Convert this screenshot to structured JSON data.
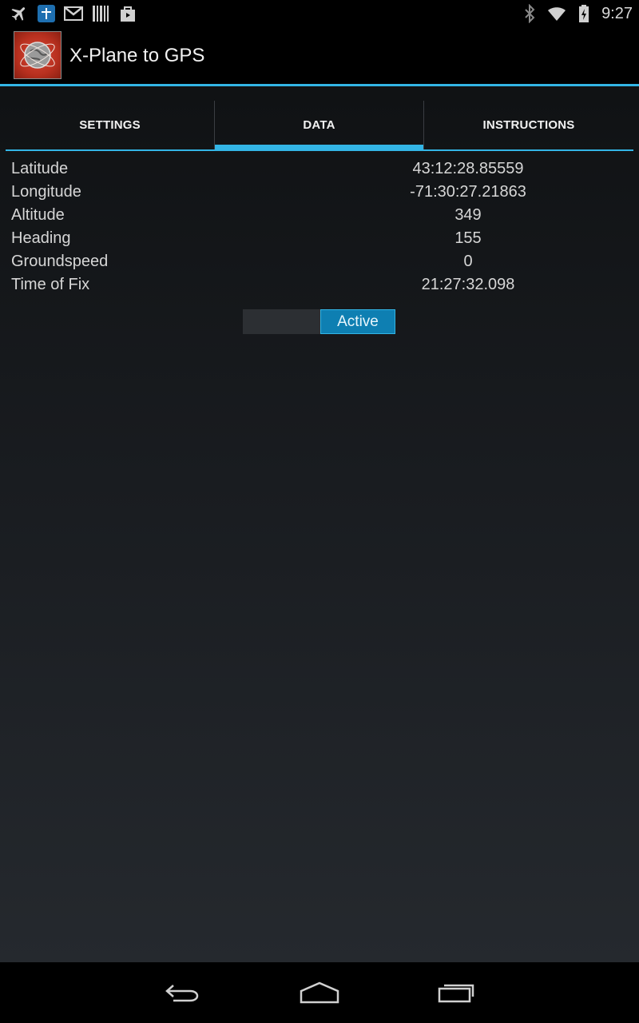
{
  "status_bar": {
    "time": "9:27",
    "left_icons": [
      "airplane-icon",
      "app-notification-icon",
      "gmail-icon",
      "barcode-icon",
      "shopping-bag-icon"
    ],
    "right_icons": [
      "bluetooth-icon",
      "wifi-icon",
      "battery-charging-icon"
    ]
  },
  "app": {
    "title": "X-Plane to GPS",
    "logo_icon": "app-logo-icon"
  },
  "tabs": [
    {
      "label": "SETTINGS",
      "selected": false
    },
    {
      "label": "DATA",
      "selected": true
    },
    {
      "label": "INSTRUCTIONS",
      "selected": false
    }
  ],
  "data_rows": [
    {
      "label": "Latitude",
      "value": "43:12:28.85559"
    },
    {
      "label": "Longitude",
      "value": "-71:30:27.21863"
    },
    {
      "label": "Altitude",
      "value": "349"
    },
    {
      "label": "Heading",
      "value": "155"
    },
    {
      "label": "Groundspeed",
      "value": "0"
    },
    {
      "label": "Time of Fix",
      "value": "21:27:32.098"
    }
  ],
  "toggle": {
    "on_label": "Active",
    "checked": true
  },
  "colors": {
    "accent": "#33b5e5",
    "toggle_on": "#0e7fb2"
  },
  "nav_bar": {
    "buttons": [
      "back-icon",
      "home-icon",
      "recents-icon"
    ]
  }
}
